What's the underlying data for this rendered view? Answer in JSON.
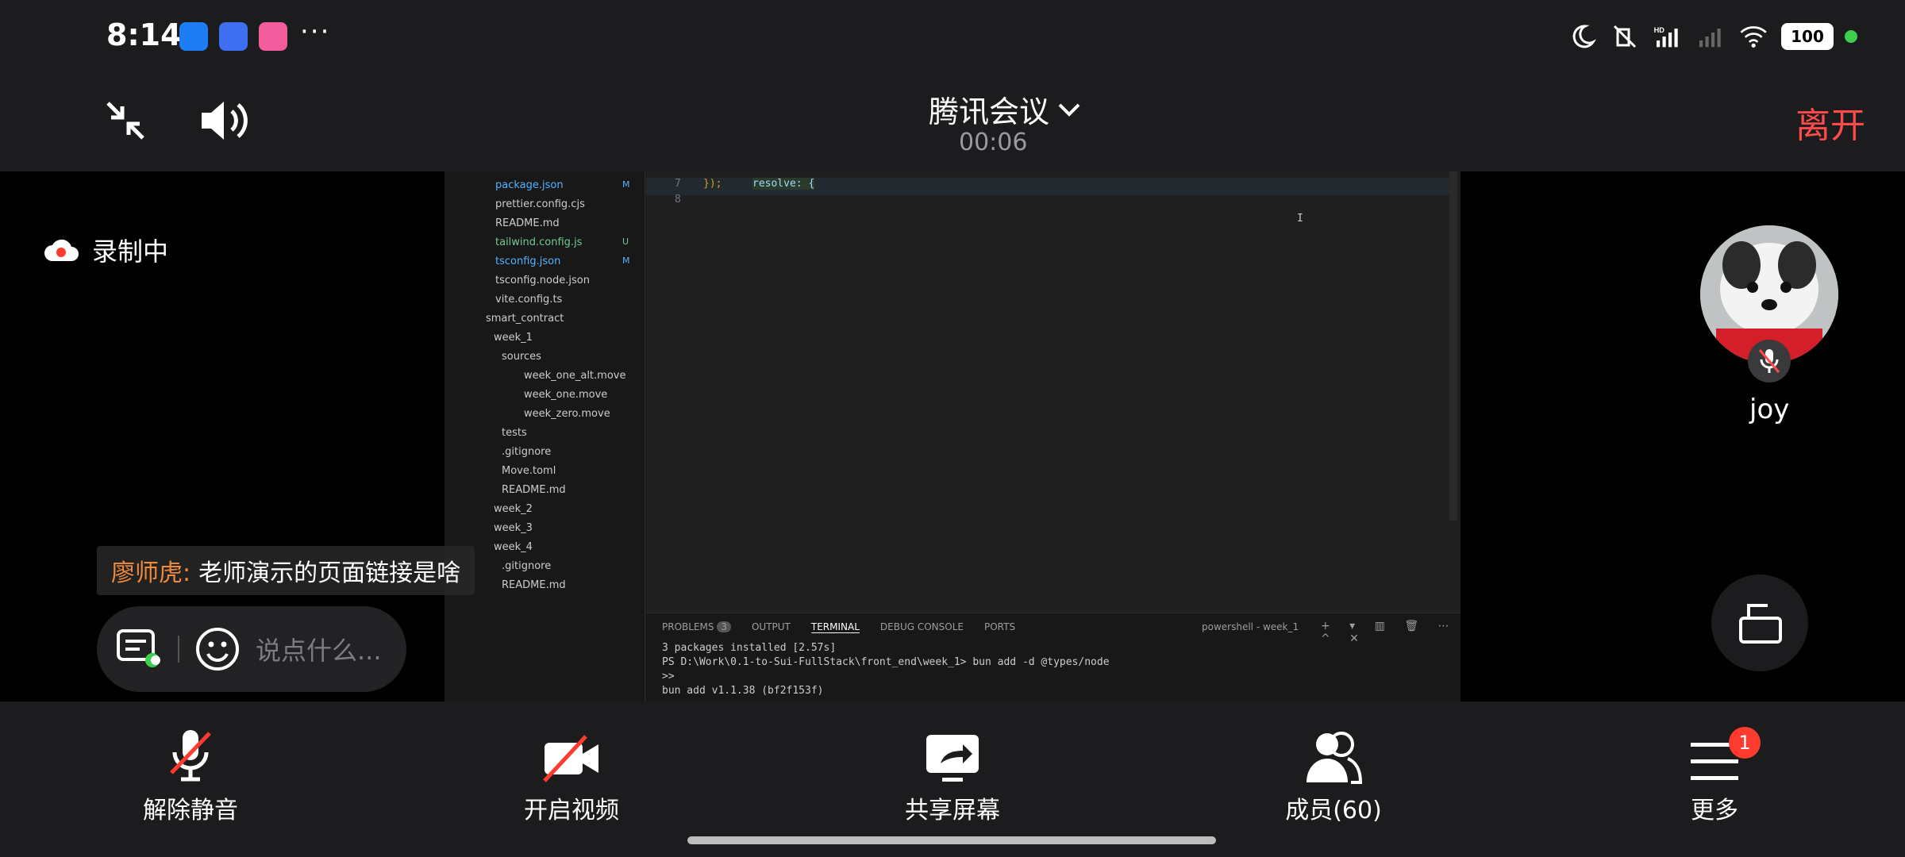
{
  "status_bar": {
    "time": "8:14",
    "more": "···",
    "battery": "100",
    "signal_hd": "HD",
    "wifi_num": "6"
  },
  "top_bar": {
    "title": "腾讯会议",
    "timer": "00:06",
    "leave": "离开"
  },
  "recording": {
    "label": "录制中"
  },
  "shared_screen": {
    "explorer": [
      {
        "name": "package.json",
        "badge": "M",
        "color": "#4fb3ff"
      },
      {
        "name": "prettier.config.cjs",
        "badge": "",
        "color": "#cccccc"
      },
      {
        "name": "README.md",
        "badge": "",
        "color": "#cccccc"
      },
      {
        "name": "tailwind.config.js",
        "badge": "U",
        "color": "#73c991"
      },
      {
        "name": "tsconfig.json",
        "badge": "M",
        "color": "#4fb3ff"
      },
      {
        "name": "tsconfig.node.json",
        "badge": "",
        "color": "#cccccc"
      },
      {
        "name": "vite.config.ts",
        "badge": "",
        "color": "#cccccc"
      },
      {
        "name": "smart_contract",
        "badge": "",
        "color": "#cccccc"
      },
      {
        "name": "week_1",
        "badge": "",
        "color": "#cccccc"
      },
      {
        "name": "sources",
        "badge": "",
        "color": "#cccccc"
      },
      {
        "name": "week_one_alt.move",
        "badge": "",
        "color": "#cccccc"
      },
      {
        "name": "week_one.move",
        "badge": "",
        "color": "#cccccc"
      },
      {
        "name": "week_zero.move",
        "badge": "",
        "color": "#cccccc"
      },
      {
        "name": "tests",
        "badge": "",
        "color": "#cccccc"
      },
      {
        "name": ".gitignore",
        "badge": "",
        "color": "#cccccc"
      },
      {
        "name": "Move.toml",
        "badge": "",
        "color": "#cccccc"
      },
      {
        "name": "README.md",
        "badge": "",
        "color": "#cccccc"
      },
      {
        "name": "week_2",
        "badge": "",
        "color": "#cccccc"
      },
      {
        "name": "week_3",
        "badge": "",
        "color": "#cccccc"
      },
      {
        "name": "week_4",
        "badge": "",
        "color": "#cccccc"
      },
      {
        "name": ".gitignore",
        "badge": "",
        "color": "#cccccc"
      },
      {
        "name": "README.md",
        "badge": "",
        "color": "#cccccc"
      }
    ],
    "code": {
      "line7_num": "7",
      "line8_num": "8",
      "line7_text": "});",
      "line7_extra": "resolve: {"
    },
    "terminal": {
      "tabs": [
        "PROBLEMS",
        "OUTPUT",
        "TERMINAL",
        "DEBUG CONSOLE",
        "PORTS"
      ],
      "problems_count": "3",
      "shell_label": "powershell - week_1",
      "line1": "3 packages installed [2.57s]",
      "line2": "PS D:\\Work\\0.1-to-Sui-FullStack\\front_end\\week_1> bun add -d @types/node",
      "line3": ">>",
      "line4": "bun add v1.1.38 (bf2f153f)"
    }
  },
  "chat": {
    "sender": "廖师虎:",
    "message": "老师演示的页面链接是啥",
    "input_placeholder": "说点什么..."
  },
  "participant": {
    "name": "joy"
  },
  "bottom_bar": {
    "unmute": "解除静音",
    "video": "开启视频",
    "share": "共享屏幕",
    "members": "成员(60)",
    "more": "更多",
    "more_badge": "1"
  },
  "colors": {
    "leave": "#ff4b4b",
    "badge": "#ff3b30",
    "sender": "#f08a3c",
    "accent_green": "#3ccf4e"
  }
}
